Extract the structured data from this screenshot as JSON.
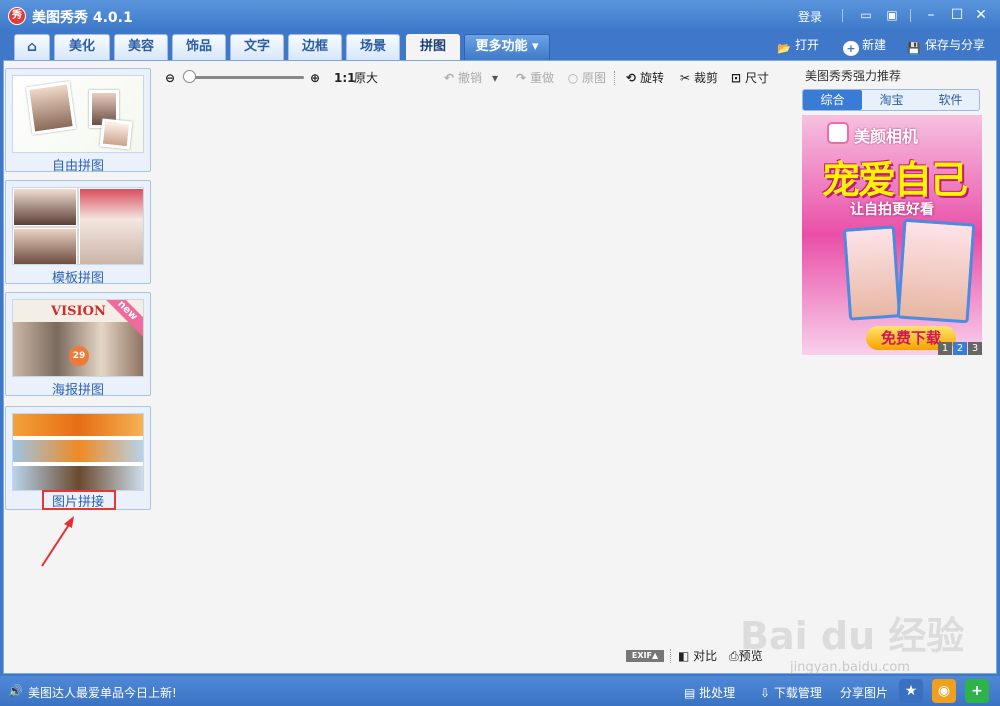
{
  "app": {
    "title": "美图秀秀 4.0.1",
    "logo_text": "秀"
  },
  "titlebar": {
    "login": "登录"
  },
  "tabs": [
    {
      "label": "⌂"
    },
    {
      "label": "美化"
    },
    {
      "label": "美容"
    },
    {
      "label": "饰品"
    },
    {
      "label": "文字"
    },
    {
      "label": "边框"
    },
    {
      "label": "场景"
    },
    {
      "label": "拼图"
    },
    {
      "label": "更多功能 ▾"
    }
  ],
  "top_actions": {
    "open": "打开",
    "new": "新建",
    "save_share": "保存与分享"
  },
  "left_panel": {
    "cards": [
      {
        "label": "自由拼图"
      },
      {
        "label": "模板拼图"
      },
      {
        "label": "海报拼图",
        "badge": "new",
        "thumb_text": "VISION",
        "thumb_number": "29"
      },
      {
        "label": "图片拼接"
      }
    ]
  },
  "toolbar": {
    "ratio": "1:1",
    "original_size": "原大",
    "undo": "撤销",
    "redo": "重做",
    "original": "原图",
    "rotate": "旋转",
    "crop": "裁剪",
    "size": "尺寸"
  },
  "recommend": {
    "title": "美图秀秀强力推荐",
    "tabs": [
      "综合",
      "淘宝",
      "软件"
    ],
    "ad": {
      "brand": "美颜相机",
      "headline": "宠爱自己",
      "subline": "让自拍更好看",
      "button": "免费下载",
      "pages": [
        "1",
        "2",
        "3"
      ]
    }
  },
  "canvas_bottom": {
    "exif": "EXIF▲",
    "compare": "对比",
    "preview": "预览"
  },
  "watermark": {
    "text": "Bai du 经验",
    "url": "jingyan.baidu.com"
  },
  "statusbar": {
    "message": "美图达人最爱单品今日上新!",
    "batch": "批处理",
    "download_manager": "下载管理",
    "share_image": "分享图片"
  },
  "colors": {
    "accent": "#3f78c8",
    "highlight": "#e33333",
    "link": "#2c63b1"
  }
}
